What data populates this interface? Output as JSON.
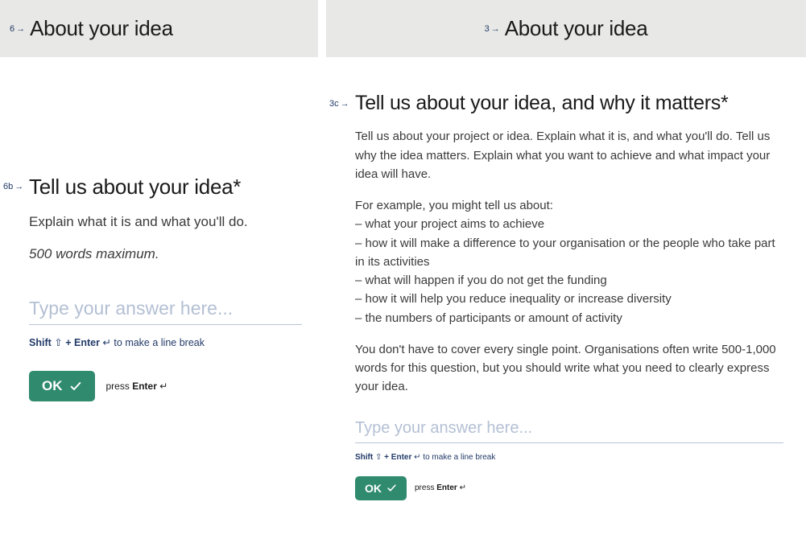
{
  "left": {
    "header": {
      "num": "6",
      "arrow": "→",
      "title": "About your idea"
    },
    "question": {
      "num": "6b",
      "arrow": "→",
      "title": "Tell us about your idea*",
      "description": "Explain what it is and what you'll do.",
      "word_limit": "500 words maximum.",
      "placeholder": "Type your answer here..."
    },
    "hint": {
      "shift": "Shift",
      "shift_symbol": "⇧",
      "plus": " + ",
      "enter": "Enter",
      "enter_symbol": "↵",
      "tail": " to make a line break"
    },
    "actions": {
      "ok_label": "OK",
      "press": "press ",
      "enter": "Enter",
      "enter_symbol": " ↵"
    }
  },
  "right": {
    "header": {
      "num": "3",
      "arrow": "→",
      "title": "About your idea"
    },
    "question": {
      "num": "3c",
      "arrow": "→",
      "title": "Tell us about your idea, and why it matters*",
      "p1": "Tell us about your project or idea. Explain what it is, and what you'll do. Tell us why the idea matters. Explain what you want to achieve and what impact your idea will have.",
      "p2_intro": "For example, you might tell us about:",
      "b1": "– what your project aims to achieve",
      "b2": "– how it will make a difference to your organisation or the people who take part in its activities",
      "b3": "– what will happen if you do not get the funding",
      "b4": "– how it will help you reduce inequality or increase diversity",
      "b5": "– the numbers of participants or amount of activity",
      "p3": "You don't have to cover every single point. Organisations often write 500-1,000 words for this question, but you should write what you need to clearly express your idea.",
      "placeholder": "Type your answer here..."
    },
    "hint": {
      "shift": "Shift",
      "shift_symbol": "⇧",
      "plus": " + ",
      "enter": "Enter",
      "enter_symbol": "↵",
      "tail": " to make a line break"
    },
    "actions": {
      "ok_label": "OK",
      "press": "press ",
      "enter": "Enter",
      "enter_symbol": " ↵"
    }
  }
}
